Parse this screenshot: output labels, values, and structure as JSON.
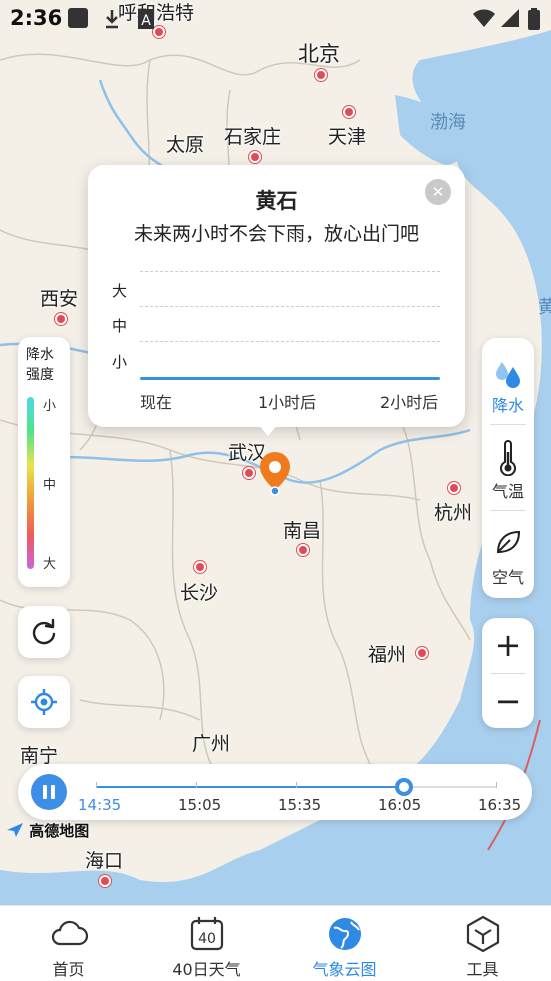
{
  "status_bar": {
    "time": "2:36"
  },
  "map": {
    "cities": [
      {
        "name": "呼和浩特"
      },
      {
        "name": "北京"
      },
      {
        "name": "天津"
      },
      {
        "name": "石家庄"
      },
      {
        "name": "太原"
      },
      {
        "name": "西安"
      },
      {
        "name": "武汉"
      },
      {
        "name": "南昌"
      },
      {
        "name": "杭州"
      },
      {
        "name": "长沙"
      },
      {
        "name": "福州"
      },
      {
        "name": "广州"
      },
      {
        "name": "南宁"
      },
      {
        "name": "海口"
      }
    ],
    "seas": [
      "渤海",
      "黄"
    ],
    "brand": "高德地图"
  },
  "popup": {
    "title": "黄石",
    "description": "未来两小时不会下雨，放心出门吧",
    "y_levels": [
      "大",
      "中",
      "小"
    ],
    "x_labels": [
      "现在",
      "1小时后",
      "2小时后"
    ],
    "close_icon": "close-icon"
  },
  "legend": {
    "title_line1": "降水",
    "title_line2": "强度",
    "levels": [
      "小",
      "中",
      "大"
    ]
  },
  "layers": [
    {
      "label": "降水",
      "icon": "rain-drop-icon",
      "active": true
    },
    {
      "label": "气温",
      "icon": "thermometer-icon",
      "active": false
    },
    {
      "label": "空气",
      "icon": "leaf-icon",
      "active": false
    }
  ],
  "zoom": {
    "in": "+",
    "out": "−"
  },
  "timeline": {
    "playing": true,
    "labels": [
      "14:35",
      "15:05",
      "15:35",
      "16:05",
      "16:35"
    ],
    "current": "14:35",
    "progress": 0.77
  },
  "tabs": [
    {
      "label": "首页",
      "icon": "cloud-icon",
      "active": false
    },
    {
      "label": "40日天气",
      "icon": "calendar-40-icon",
      "active": false,
      "icon_text": "40"
    },
    {
      "label": "气象云图",
      "icon": "earth-icon",
      "active": true
    },
    {
      "label": "工具",
      "icon": "tools-icon",
      "active": false
    }
  ],
  "colors": {
    "accent": "#3d8ee6",
    "city_dot": "#e24b55",
    "marker": "#f07a1e"
  }
}
